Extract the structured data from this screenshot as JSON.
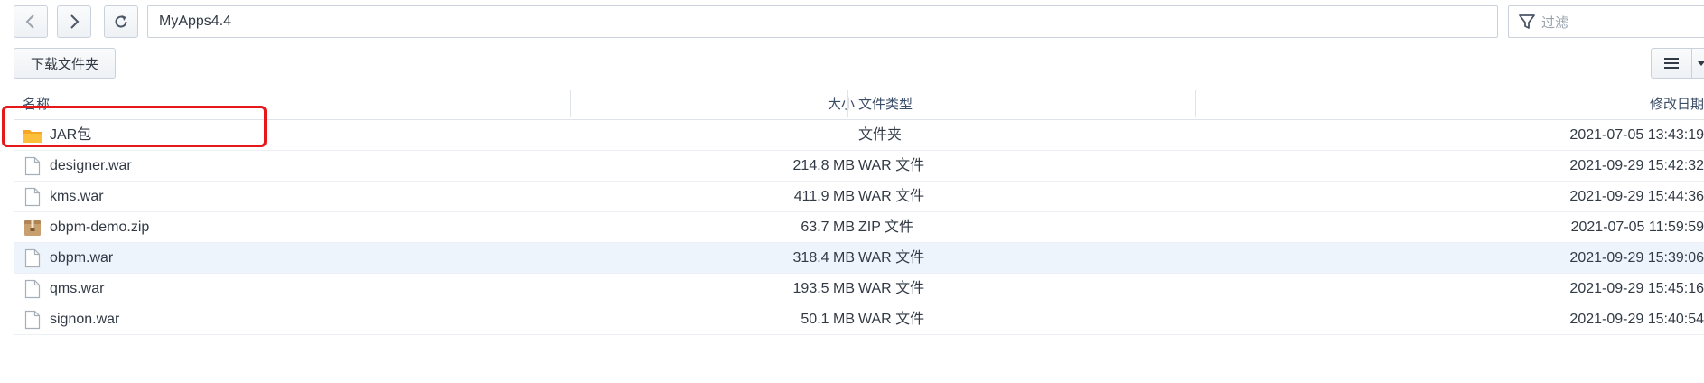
{
  "toolbar": {
    "path": "MyApps4.4",
    "filter_placeholder": "过滤",
    "download_folder_label": "下载文件夹"
  },
  "table": {
    "columns": {
      "name": "名称",
      "size": "大小",
      "type": "文件类型",
      "modified": "修改日期"
    },
    "rows": [
      {
        "name": "JAR包",
        "size": "",
        "type": "文件夹",
        "modified": "2021-07-05 13:43:19",
        "icon": "folder-icon"
      },
      {
        "name": "designer.war",
        "size": "214.8 MB",
        "type": "WAR 文件",
        "modified": "2021-09-29 15:42:32",
        "icon": "file-icon"
      },
      {
        "name": "kms.war",
        "size": "411.9 MB",
        "type": "WAR 文件",
        "modified": "2021-09-29 15:44:36",
        "icon": "file-icon"
      },
      {
        "name": "obpm-demo.zip",
        "size": "63.7 MB",
        "type": "ZIP 文件",
        "modified": "2021-07-05 11:59:59",
        "icon": "archive-icon"
      },
      {
        "name": "obpm.war",
        "size": "318.4 MB",
        "type": "WAR 文件",
        "modified": "2021-09-29 15:39:06",
        "icon": "file-icon"
      },
      {
        "name": "qms.war",
        "size": "193.5 MB",
        "type": "WAR 文件",
        "modified": "2021-09-29 15:45:16",
        "icon": "file-icon"
      },
      {
        "name": "signon.war",
        "size": "50.1 MB",
        "type": "WAR 文件",
        "modified": "2021-09-29 15:40:54",
        "icon": "file-icon"
      }
    ]
  },
  "colors": {
    "selected_row": "#eef4fc",
    "highlight_box": "#e5191c",
    "folder": "#f5a623"
  }
}
